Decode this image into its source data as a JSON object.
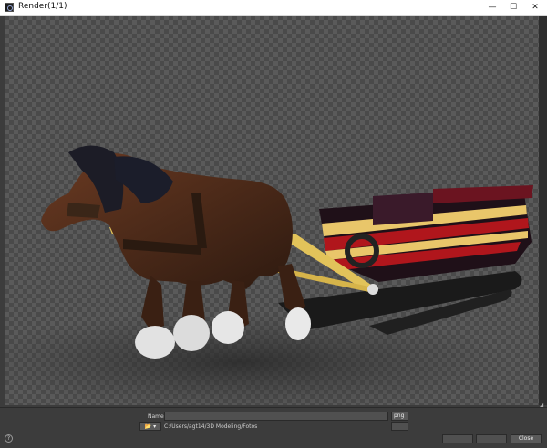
{
  "window": {
    "title": "Render(1/1)",
    "minimize": "—",
    "maximize": "☐",
    "close": "✕"
  },
  "render": {
    "corner": "◢"
  },
  "output": {
    "name_label": "Name",
    "name_value": "",
    "format": "png ▾",
    "folder": "📂 ▾",
    "path": "C:/Users/agt14/3D Modeling/Fotos"
  },
  "footer": {
    "help": "?",
    "button1": "",
    "button2": "",
    "close": "Close"
  }
}
